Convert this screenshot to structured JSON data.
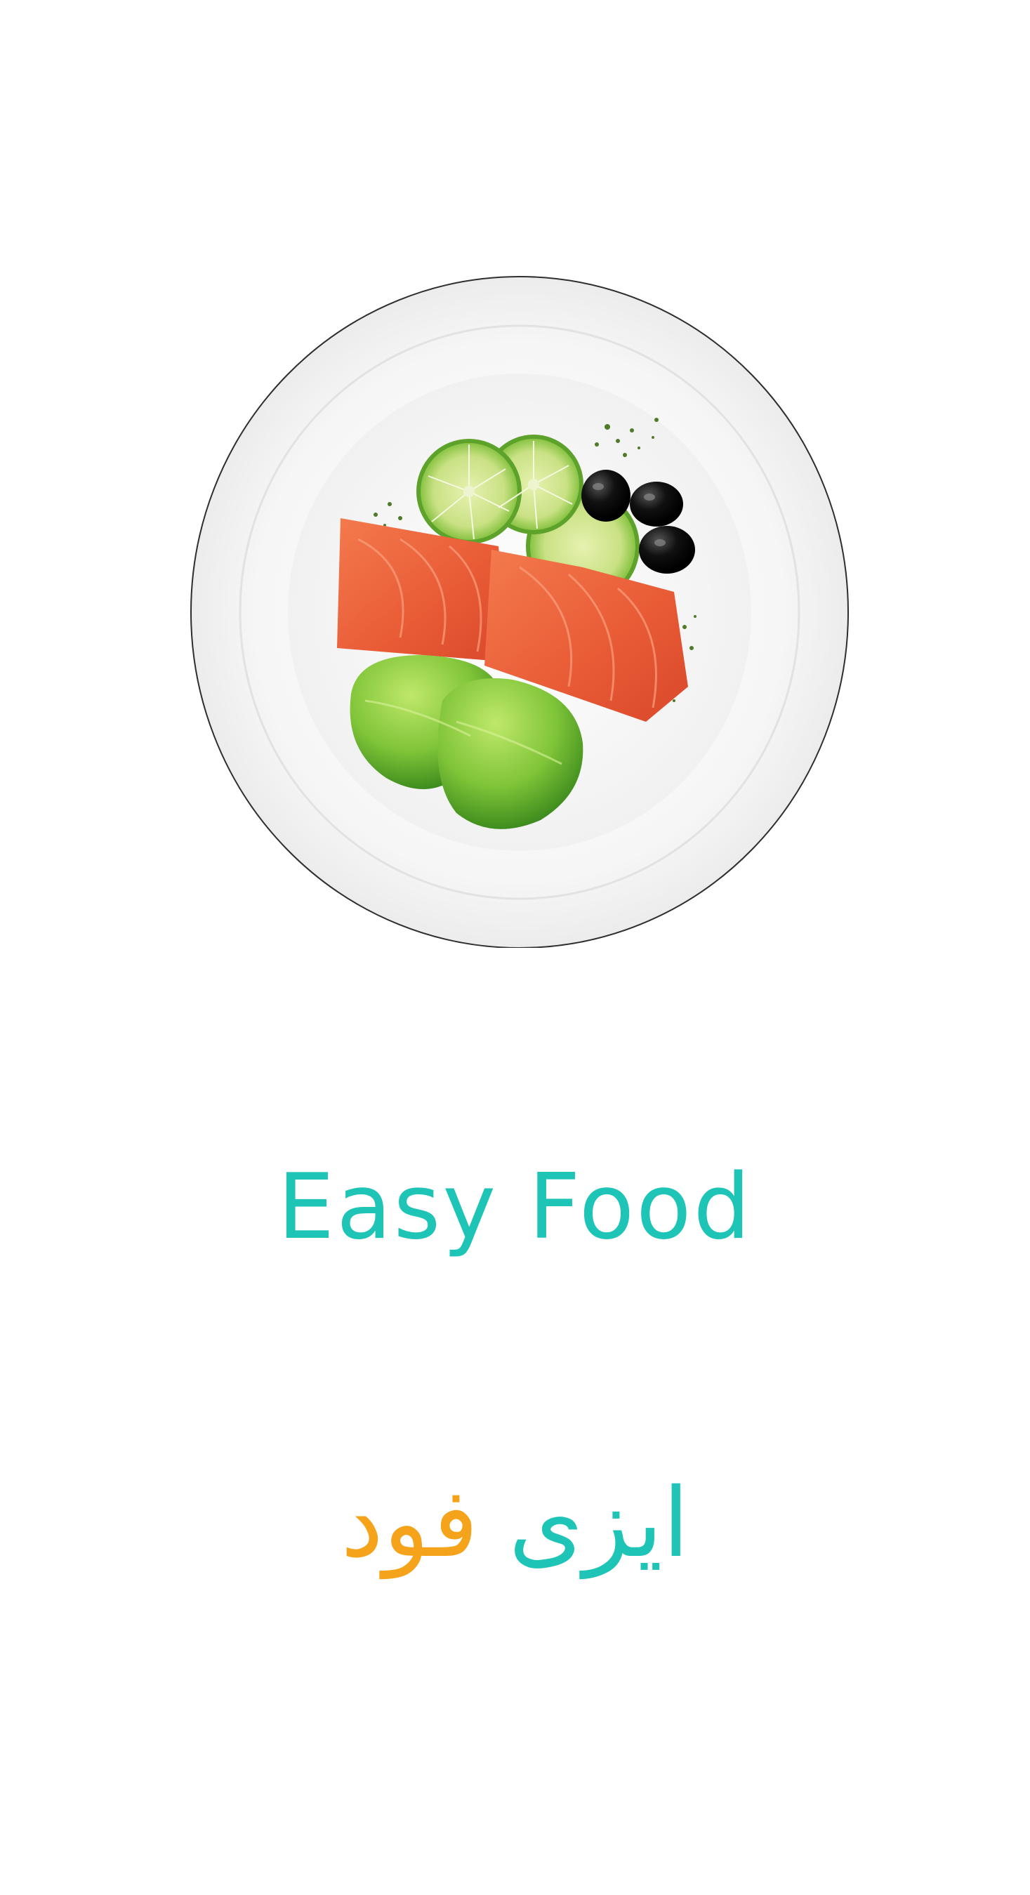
{
  "splash": {
    "illustration": "plate-with-salmon-lime-olives-lettuce",
    "title_en": "Easy Food",
    "title_fa_part1": "ایزی",
    "title_fa_part2": "فود"
  },
  "colors": {
    "background": "#ffffff",
    "teal": "#1ec4b6",
    "orange": "#f5a31a",
    "plate_outline": "#3a3a3a",
    "plate_fill": "#f7f7f7"
  }
}
